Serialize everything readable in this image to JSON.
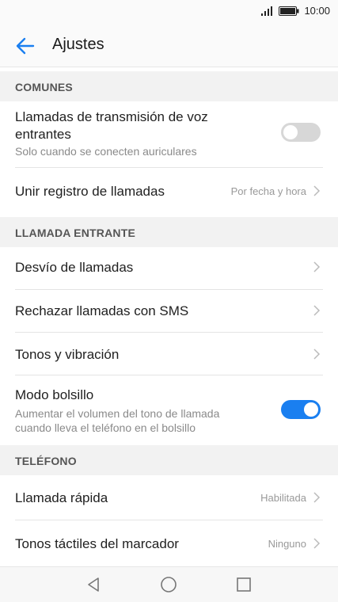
{
  "status": {
    "time": "10:00",
    "signal_icon": "signal-icon",
    "battery_icon": "battery-icon"
  },
  "header": {
    "title": "Ajustes",
    "back_icon": "arrow-left-icon"
  },
  "sections": {
    "comunes": "COMUNES",
    "llamada_entrante": "LLAMADA ENTRANTE",
    "telefono": "TELÉFONO"
  },
  "items": {
    "voz": {
      "label_line1": "Llamadas de transmisión de voz",
      "label_line2": "entrantes",
      "sub": "Solo cuando se conecten auriculares",
      "toggle_on": false
    },
    "unir": {
      "label": "Unir registro de llamadas",
      "value": "Por fecha y hora"
    },
    "desvio": {
      "label": "Desvío de llamadas"
    },
    "rechazar": {
      "label": "Rechazar llamadas con SMS"
    },
    "tonos": {
      "label": "Tonos y vibración"
    },
    "bolsillo": {
      "label": "Modo bolsillo",
      "sub_line1": "Aumentar el volumen del tono de llamada",
      "sub_line2": "cuando lleva el teléfono en el bolsillo",
      "toggle_on": true
    },
    "rapida": {
      "label": "Llamada rápida",
      "value": "Habilitada"
    },
    "tactiles": {
      "label": "Tonos táctiles del marcador",
      "value": "Ninguno"
    }
  },
  "colors": {
    "accent": "#1a7ff0",
    "toggle_off": "#d7d7d7"
  },
  "navbar": {
    "back_icon": "nav-back-icon",
    "home_icon": "nav-home-icon",
    "recents_icon": "nav-recents-icon"
  }
}
